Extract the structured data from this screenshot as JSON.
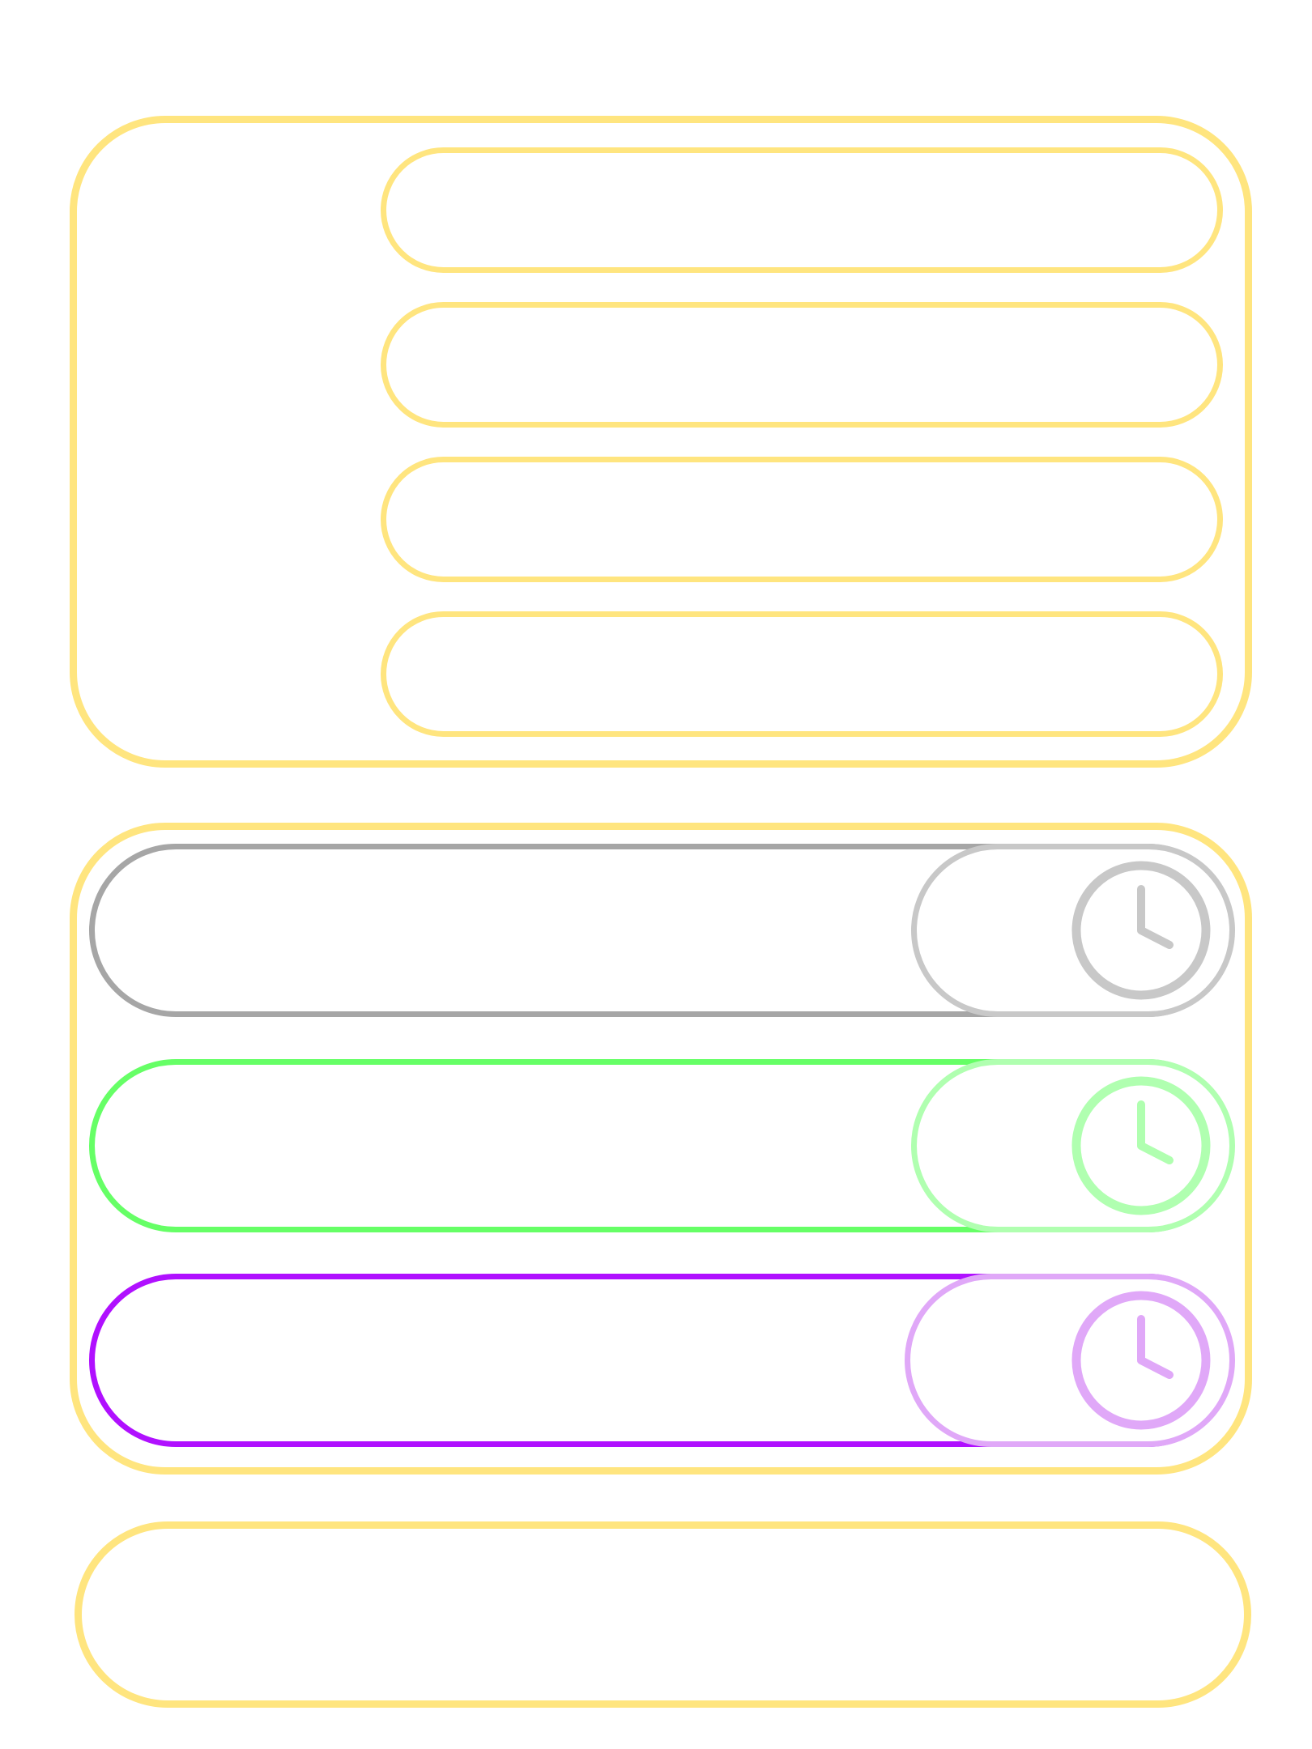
{
  "theme": {
    "accent": "#FFE57F"
  },
  "top_panel": {
    "slots": [
      {
        "label": ""
      },
      {
        "label": ""
      },
      {
        "label": ""
      },
      {
        "label": ""
      }
    ]
  },
  "middle_panel": {
    "rows": [
      {
        "state": "neutral",
        "track_color": "#A6A6A6",
        "knob_color": "#C8C8C8",
        "icon": "clock-icon",
        "label": ""
      },
      {
        "state": "active",
        "track_color": "#66FF66",
        "knob_color": "#B0FFB0",
        "icon": "clock-icon",
        "label": ""
      },
      {
        "state": "selected",
        "track_color": "#B010FF",
        "knob_color": "#E0A8F8",
        "icon": "clock-icon",
        "label": ""
      }
    ]
  },
  "bottom_panel": {
    "label": ""
  }
}
